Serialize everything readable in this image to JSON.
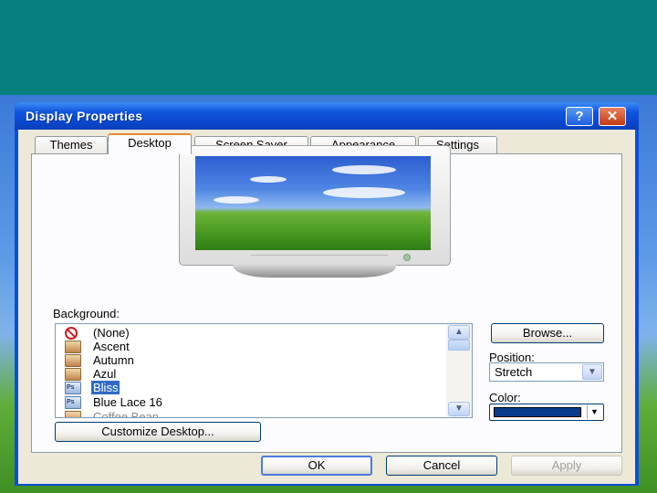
{
  "window": {
    "title": "Display Properties",
    "help_icon": "question-mark-icon",
    "close_icon": "close-x-icon"
  },
  "tabs": [
    {
      "label": "Themes"
    },
    {
      "label": "Desktop",
      "active": true
    },
    {
      "label": "Screen Saver"
    },
    {
      "label": "Appearance"
    },
    {
      "label": "Settings"
    }
  ],
  "background": {
    "label": "Background:",
    "items": [
      {
        "label": "(None)",
        "icon": "no-symbol-icon"
      },
      {
        "label": "Ascent",
        "icon": "image-file-icon"
      },
      {
        "label": "Autumn",
        "icon": "image-file-icon"
      },
      {
        "label": "Azul",
        "icon": "image-file-icon"
      },
      {
        "label": "Bliss",
        "icon": "photoshop-file-icon",
        "selected": true
      },
      {
        "label": "Blue Lace 16",
        "icon": "photoshop-file-icon"
      },
      {
        "label": "Coffee Bean",
        "icon": "image-file-icon"
      }
    ]
  },
  "buttons": {
    "browse": "Browse...",
    "customize": "Customize Desktop...",
    "ok": "OK",
    "cancel": "Cancel",
    "apply": "Apply"
  },
  "position": {
    "label": "Position:",
    "value": "Stretch"
  },
  "color": {
    "label": "Color:",
    "value": "#0a3c8c"
  }
}
